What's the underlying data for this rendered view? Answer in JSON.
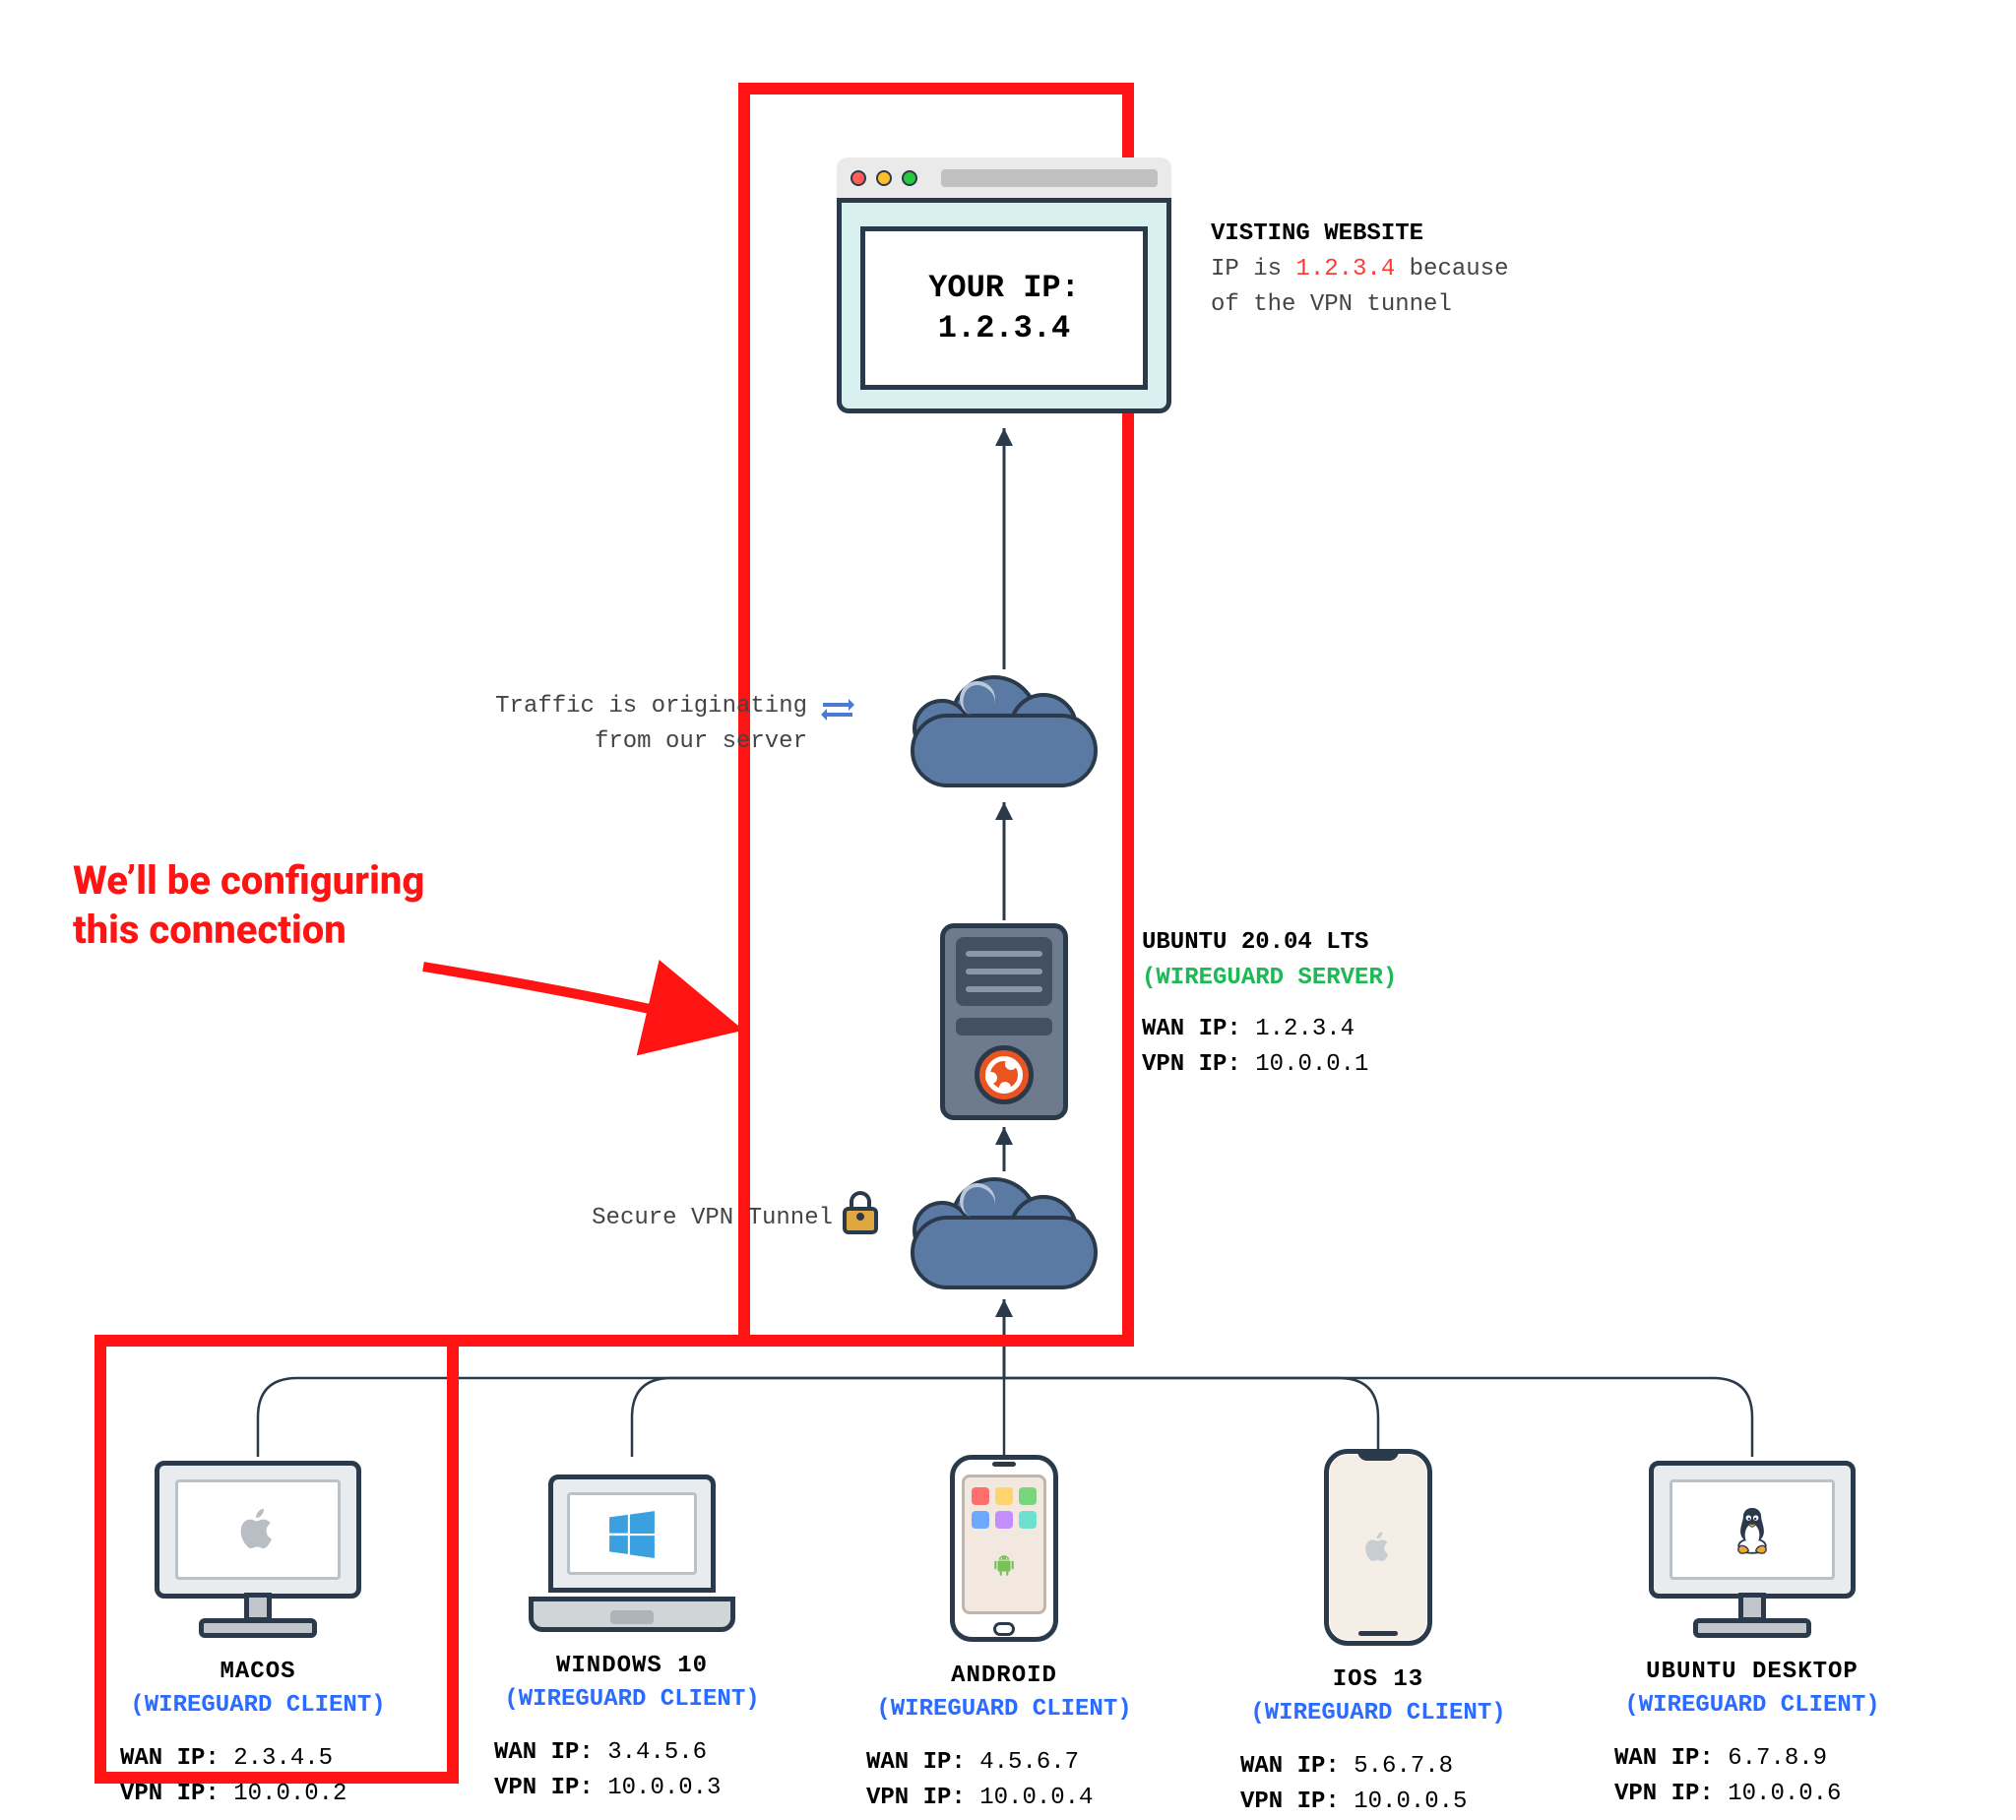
{
  "browser": {
    "line1": "YOUR IP:",
    "ip": "1.2.3.4"
  },
  "website_caption": {
    "title": "VISTING WEBSITE",
    "line_before": "IP is ",
    "ip": "1.2.3.4",
    "line_after": " because",
    "line2": "of the VPN tunnel"
  },
  "traffic_caption": {
    "line1": "Traffic is originating",
    "line2": "from our server"
  },
  "server_caption": {
    "title": "UBUNTU 20.04 LTS",
    "subtitle": "(WIREGUARD SERVER)",
    "wan_label": "WAN IP:",
    "wan_value": "1.2.3.4",
    "vpn_label": "VPN IP:",
    "vpn_value": "10.0.0.1"
  },
  "tunnel_caption": "Secure VPN Tunnel",
  "config_caption": {
    "line1": "We’ll be configuring",
    "line2": "this connection"
  },
  "clients": [
    {
      "name": "MACOS",
      "role": "(WIREGUARD CLIENT)",
      "wan_label": "WAN IP:",
      "wan": "2.3.4.5",
      "vpn_label": "VPN IP:",
      "vpn": "10.0.0.2"
    },
    {
      "name": "WINDOWS 10",
      "role": "(WIREGUARD CLIENT)",
      "wan_label": "WAN IP:",
      "wan": "3.4.5.6",
      "vpn_label": "VPN IP:",
      "vpn": "10.0.0.3"
    },
    {
      "name": "ANDROID",
      "role": "(WIREGUARD CLIENT)",
      "wan_label": "WAN IP:",
      "wan": "4.5.6.7",
      "vpn_label": "VPN IP:",
      "vpn": "10.0.0.4"
    },
    {
      "name": "IOS 13",
      "role": "(WIREGUARD CLIENT)",
      "wan_label": "WAN IP:",
      "wan": "5.6.7.8",
      "vpn_label": "VPN IP:",
      "vpn": "10.0.0.5"
    },
    {
      "name": "UBUNTU DESKTOP",
      "role": "(WIREGUARD CLIENT)",
      "wan_label": "WAN IP:",
      "wan": "6.7.8.9",
      "vpn_label": "VPN IP:",
      "vpn": "10.0.0.6"
    }
  ]
}
